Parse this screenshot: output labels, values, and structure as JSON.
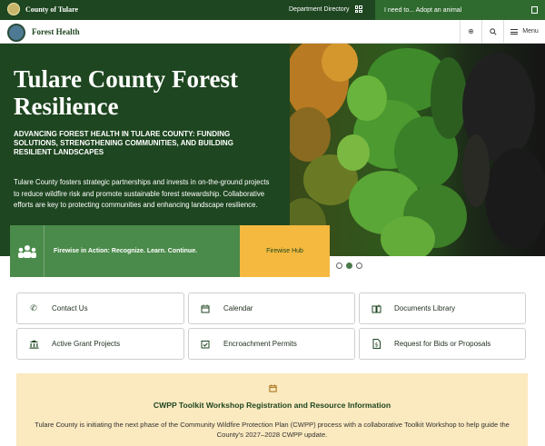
{
  "topbar": {
    "county_name": "County of Tulare",
    "department_directory": "Department Directory",
    "ineed_placeholder": "I need to... Adopt an animal"
  },
  "header": {
    "site_title": "Forest Health",
    "menu_label": "Menu"
  },
  "hero": {
    "title": "Tulare County Forest Resilience",
    "subtitle": "ADVANCING FOREST HEALTH IN TULARE COUNTY: FUNDING SOLUTIONS, STRENGTHENING COMMUNITIES, AND BUILDING RESILIENT LANDSCAPES",
    "body": "Tulare County fosters strategic partnerships and invests in on-the-ground projects to reduce wildfire risk and promote sustainable forest stewardship. Collaborative efforts are key to protecting communities and enhancing landscape resilience.",
    "callout_text": "Firewise in Action: Recognize. Learn. Continue.",
    "callout_button": "Firewise Hub",
    "carousel_total": 3,
    "carousel_active": 2
  },
  "quick_links": [
    {
      "label": "Contact Us",
      "icon": "phone-icon"
    },
    {
      "label": "Calendar",
      "icon": "calendar-icon"
    },
    {
      "label": "Documents Library",
      "icon": "book-icon"
    },
    {
      "label": "Active Grant Projects",
      "icon": "bank-icon"
    },
    {
      "label": "Encroachment Permits",
      "icon": "check-calendar-icon"
    },
    {
      "label": "Request for Bids or Proposals",
      "icon": "document-dollar-icon"
    }
  ],
  "notice": {
    "icon": "calendar-icon",
    "title": "CWPP Toolkit Workshop Registration and Resource Information",
    "body": "Tulare County is initiating the next phase of the Community Wildfire Protection Plan (CWPP) process with a collaborative Toolkit Workshop to help guide the County's 2027–2028 CWPP update."
  },
  "colors": {
    "primary_green": "#1e4620",
    "callout_green": "#4a8a4a",
    "accent_yellow": "#f4b93e",
    "notice_bg": "#fbe9bf"
  }
}
